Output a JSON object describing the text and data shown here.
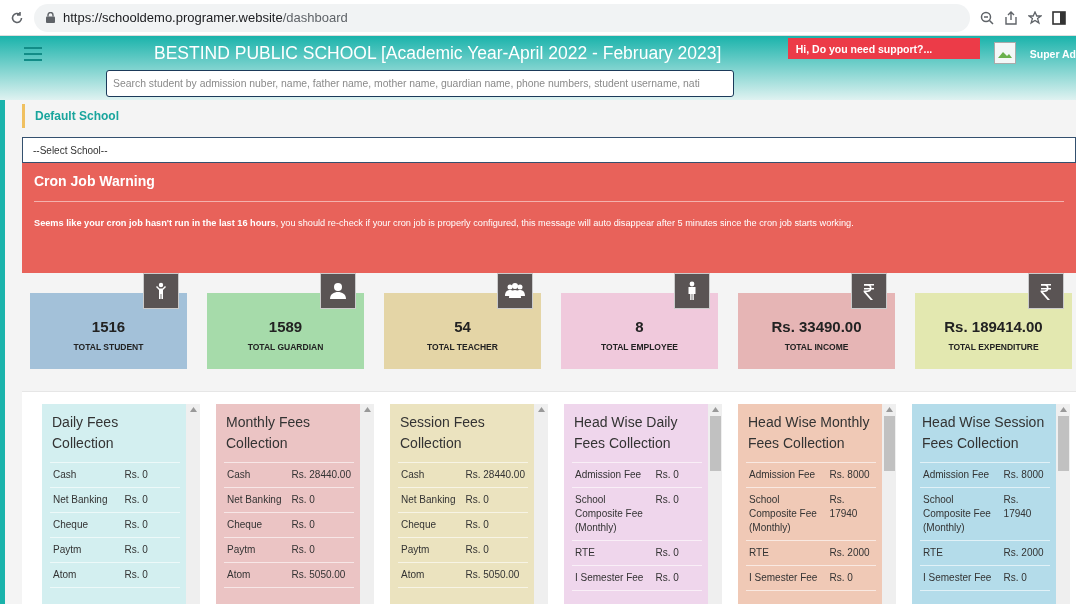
{
  "browser": {
    "url_host": "https://schooldemo.programer.website",
    "url_path": "/dashboard"
  },
  "header": {
    "title": "BESTIND PUBLIC SCHOOL [Academic Year-April 2022 - February 2023]",
    "search_placeholder": "Search student by admission nuber, name, father name, mother name, guardian name, phone numbers, student username, nati",
    "support": "Hi, Do you need support?...",
    "user": "Super Ad"
  },
  "school": {
    "label": "Default School",
    "select": "--Select School--"
  },
  "warning": {
    "title": "Cron Job Warning",
    "message": "**Seems like your cron job hasn't run in the last 16 hours**, you should re-check if your cron job is properly configured, this message will auto disappear after 5 minutes since the cron job starts working."
  },
  "stats": [
    {
      "kind": "student",
      "value": "1516",
      "label": "TOTAL STUDENT",
      "color": "#a3c1d9"
    },
    {
      "kind": "guardian",
      "value": "1589",
      "label": "TOTAL GUARDIAN",
      "color": "#a6dbaa"
    },
    {
      "kind": "teacher",
      "value": "54",
      "label": "TOTAL TEACHER",
      "color": "#e4d5a6"
    },
    {
      "kind": "employee",
      "value": "8",
      "label": "TOTAL EMPLOYEE",
      "color": "#f0c9dc"
    },
    {
      "kind": "income",
      "value": "Rs. 33490.00",
      "label": "TOTAL INCOME",
      "color": "#e6b5b5"
    },
    {
      "kind": "expenditure",
      "value": "Rs. 189414.00",
      "label": "TOTAL EXPENDITURE",
      "color": "#e3e8b0"
    }
  ],
  "panels": [
    {
      "kind": "mode",
      "title": "Daily Fees Collection",
      "color": "#d3eff0",
      "rows": [
        [
          "Cash",
          "Rs. 0"
        ],
        [
          "Net Banking",
          "Rs. 0"
        ],
        [
          "Cheque",
          "Rs. 0"
        ],
        [
          "Paytm",
          "Rs. 0"
        ],
        [
          "Atom",
          "Rs. 0"
        ]
      ]
    },
    {
      "kind": "mode",
      "title": "Monthly Fees Collection",
      "color": "#ebc4c4",
      "rows": [
        [
          "Cash",
          "Rs. 28440.00"
        ],
        [
          "Net Banking",
          "Rs. 0"
        ],
        [
          "Cheque",
          "Rs. 0"
        ],
        [
          "Paytm",
          "Rs. 0"
        ],
        [
          "Atom",
          "Rs. 5050.00"
        ]
      ]
    },
    {
      "kind": "mode",
      "title": "Session Fees Collection",
      "color": "#ebe3bf",
      "rows": [
        [
          "Cash",
          "Rs. 28440.00"
        ],
        [
          "Net Banking",
          "Rs. 0"
        ],
        [
          "Cheque",
          "Rs. 0"
        ],
        [
          "Paytm",
          "Rs. 0"
        ],
        [
          "Atom",
          "Rs. 5050.00"
        ]
      ]
    },
    {
      "kind": "head",
      "title": "Head Wise Daily Fees Collection",
      "color": "#efd6ec",
      "rows": [
        [
          "Admission Fee",
          "Rs. 0"
        ],
        [
          "School Composite Fee (Monthly)",
          "Rs. 0"
        ],
        [
          "RTE",
          "Rs. 0"
        ],
        [
          "I Semester Fee",
          "Rs. 0"
        ]
      ]
    },
    {
      "kind": "head",
      "title": "Head Wise Monthly Fees Collection",
      "color": "#f0c9b6",
      "rows": [
        [
          "Admission Fee",
          "Rs. 8000"
        ],
        [
          "School Composite Fee (Monthly)",
          "Rs. 17940"
        ],
        [
          "RTE",
          "Rs. 2000"
        ],
        [
          "I Semester Fee",
          "Rs. 0"
        ]
      ]
    },
    {
      "kind": "head",
      "title": "Head Wise Session Fees Collection",
      "color": "#b4dcea",
      "rows": [
        [
          "Admission Fee",
          "Rs. 8000"
        ],
        [
          "School Composite Fee (Monthly)",
          "Rs. 17940"
        ],
        [
          "RTE",
          "Rs. 2000"
        ],
        [
          "I Semester Fee",
          "Rs. 0"
        ]
      ]
    }
  ]
}
